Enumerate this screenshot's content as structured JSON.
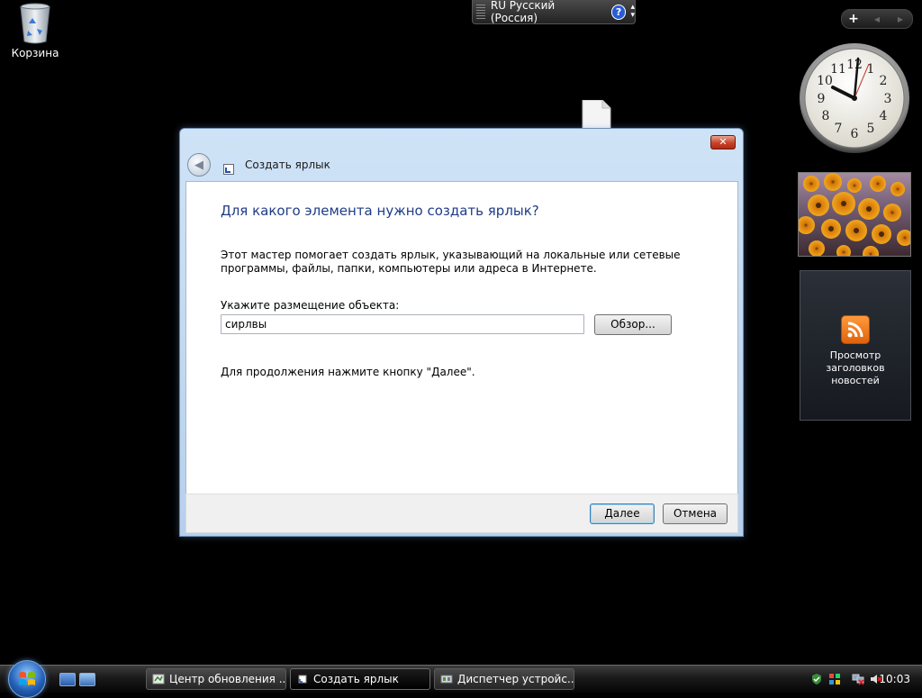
{
  "desktop": {
    "recycle_bin_label": "Корзина"
  },
  "language_bar": {
    "language": "RU Русский (Россия)",
    "help": "?"
  },
  "sidebar": {
    "feed_gadget_text": "Просмотр заголовков новостей",
    "clock_numbers": [
      "12",
      "1",
      "2",
      "3",
      "4",
      "5",
      "6",
      "7",
      "8",
      "9",
      "10",
      "11"
    ],
    "clock_time": "10:03"
  },
  "window": {
    "title": "Создать ярлык",
    "heading": "Для какого элемента нужно создать ярлык?",
    "description": "Этот мастер помогает создать ярлык, указывающий на локальные или сетевые программы, файлы, папки, компьютеры или адреса в Интернете.",
    "location_label": "Укажите размещение объекта:",
    "location_value": "сирлвы",
    "browse_label": "Обзор...",
    "hint": "Для продолжения нажмите кнопку \"Далее\".",
    "next_label": "Далее",
    "cancel_label": "Отмена"
  },
  "taskbar": {
    "buttons": [
      {
        "label": "Центр обновления ..."
      },
      {
        "label": "Создать ярлык"
      },
      {
        "label": "Диспетчер устройс..."
      }
    ],
    "time": "10:03"
  }
}
